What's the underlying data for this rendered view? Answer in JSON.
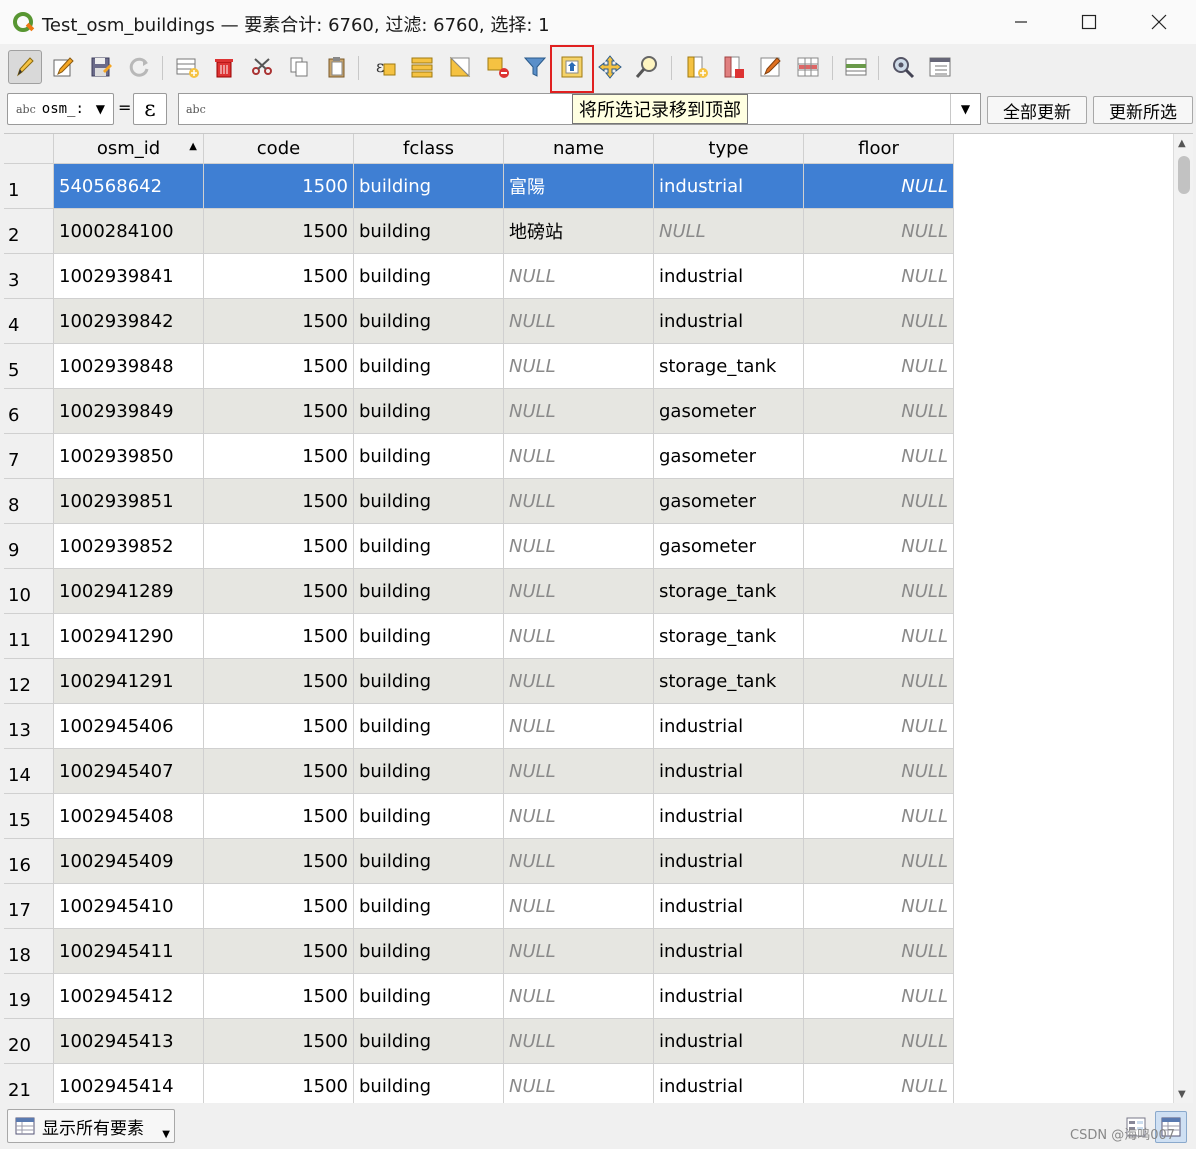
{
  "window": {
    "title": "Test_osm_buildings — 要素合计: 6760, 过滤: 6760, 选择: 1"
  },
  "toolbar": {
    "tooltip": "将所选记录移到顶部",
    "icons": [
      "edit-pencil-icon",
      "multi-edit-icon",
      "save-edits-icon",
      "reload-icon",
      "add-feature-icon",
      "delete-feature-icon",
      "cut-icon",
      "copy-icon",
      "paste-icon",
      "select-expression-icon",
      "select-all-icon",
      "invert-selection-icon",
      "deselect-icon",
      "filter-icon",
      "move-selection-to-top-icon",
      "pan-to-selection-icon",
      "zoom-to-selection-icon",
      "new-field-icon",
      "delete-field-icon",
      "field-calculator-icon",
      "conditional-formatting-icon",
      "dock-table-icon",
      "actions-icon",
      "organize-columns-icon"
    ]
  },
  "filter": {
    "field_type": "abc",
    "field_value": "osm_:",
    "equals": "=",
    "expression_symbol": "ε",
    "input_type": "abc",
    "update_all": "全部更新",
    "update_selected": "更新所选"
  },
  "table": {
    "columns": [
      "osm_id",
      "code",
      "fclass",
      "name",
      "type",
      "floor"
    ],
    "sorted_column": "osm_id",
    "rows": [
      {
        "n": "1",
        "osm_id": "540568642",
        "code": "1500",
        "fclass": "building",
        "name": "富陽",
        "type": "industrial",
        "floor": "NULL",
        "selected": true
      },
      {
        "n": "2",
        "osm_id": "1000284100",
        "code": "1500",
        "fclass": "building",
        "name": "地磅站",
        "type": "NULL",
        "floor": "NULL"
      },
      {
        "n": "3",
        "osm_id": "1002939841",
        "code": "1500",
        "fclass": "building",
        "name": "NULL",
        "type": "industrial",
        "floor": "NULL"
      },
      {
        "n": "4",
        "osm_id": "1002939842",
        "code": "1500",
        "fclass": "building",
        "name": "NULL",
        "type": "industrial",
        "floor": "NULL"
      },
      {
        "n": "5",
        "osm_id": "1002939848",
        "code": "1500",
        "fclass": "building",
        "name": "NULL",
        "type": "storage_tank",
        "floor": "NULL"
      },
      {
        "n": "6",
        "osm_id": "1002939849",
        "code": "1500",
        "fclass": "building",
        "name": "NULL",
        "type": "gasometer",
        "floor": "NULL"
      },
      {
        "n": "7",
        "osm_id": "1002939850",
        "code": "1500",
        "fclass": "building",
        "name": "NULL",
        "type": "gasometer",
        "floor": "NULL"
      },
      {
        "n": "8",
        "osm_id": "1002939851",
        "code": "1500",
        "fclass": "building",
        "name": "NULL",
        "type": "gasometer",
        "floor": "NULL"
      },
      {
        "n": "9",
        "osm_id": "1002939852",
        "code": "1500",
        "fclass": "building",
        "name": "NULL",
        "type": "gasometer",
        "floor": "NULL"
      },
      {
        "n": "10",
        "osm_id": "1002941289",
        "code": "1500",
        "fclass": "building",
        "name": "NULL",
        "type": "storage_tank",
        "floor": "NULL"
      },
      {
        "n": "11",
        "osm_id": "1002941290",
        "code": "1500",
        "fclass": "building",
        "name": "NULL",
        "type": "storage_tank",
        "floor": "NULL"
      },
      {
        "n": "12",
        "osm_id": "1002941291",
        "code": "1500",
        "fclass": "building",
        "name": "NULL",
        "type": "storage_tank",
        "floor": "NULL"
      },
      {
        "n": "13",
        "osm_id": "1002945406",
        "code": "1500",
        "fclass": "building",
        "name": "NULL",
        "type": "industrial",
        "floor": "NULL"
      },
      {
        "n": "14",
        "osm_id": "1002945407",
        "code": "1500",
        "fclass": "building",
        "name": "NULL",
        "type": "industrial",
        "floor": "NULL"
      },
      {
        "n": "15",
        "osm_id": "1002945408",
        "code": "1500",
        "fclass": "building",
        "name": "NULL",
        "type": "industrial",
        "floor": "NULL"
      },
      {
        "n": "16",
        "osm_id": "1002945409",
        "code": "1500",
        "fclass": "building",
        "name": "NULL",
        "type": "industrial",
        "floor": "NULL"
      },
      {
        "n": "17",
        "osm_id": "1002945410",
        "code": "1500",
        "fclass": "building",
        "name": "NULL",
        "type": "industrial",
        "floor": "NULL"
      },
      {
        "n": "18",
        "osm_id": "1002945411",
        "code": "1500",
        "fclass": "building",
        "name": "NULL",
        "type": "industrial",
        "floor": "NULL"
      },
      {
        "n": "19",
        "osm_id": "1002945412",
        "code": "1500",
        "fclass": "building",
        "name": "NULL",
        "type": "industrial",
        "floor": "NULL"
      },
      {
        "n": "20",
        "osm_id": "1002945413",
        "code": "1500",
        "fclass": "building",
        "name": "NULL",
        "type": "industrial",
        "floor": "NULL"
      },
      {
        "n": "21",
        "osm_id": "1002945414",
        "code": "1500",
        "fclass": "building",
        "name": "NULL",
        "type": "industrial",
        "floor": "NULL"
      }
    ]
  },
  "bottom": {
    "show_all": "显示所有要素",
    "watermark": "CSDN @海鸣007"
  },
  "colors": {
    "selection": "#3f7fd3",
    "alt_row": "#e6e6e1",
    "highlight_border": "#e02020",
    "tooltip_bg": "#ffffe1"
  }
}
